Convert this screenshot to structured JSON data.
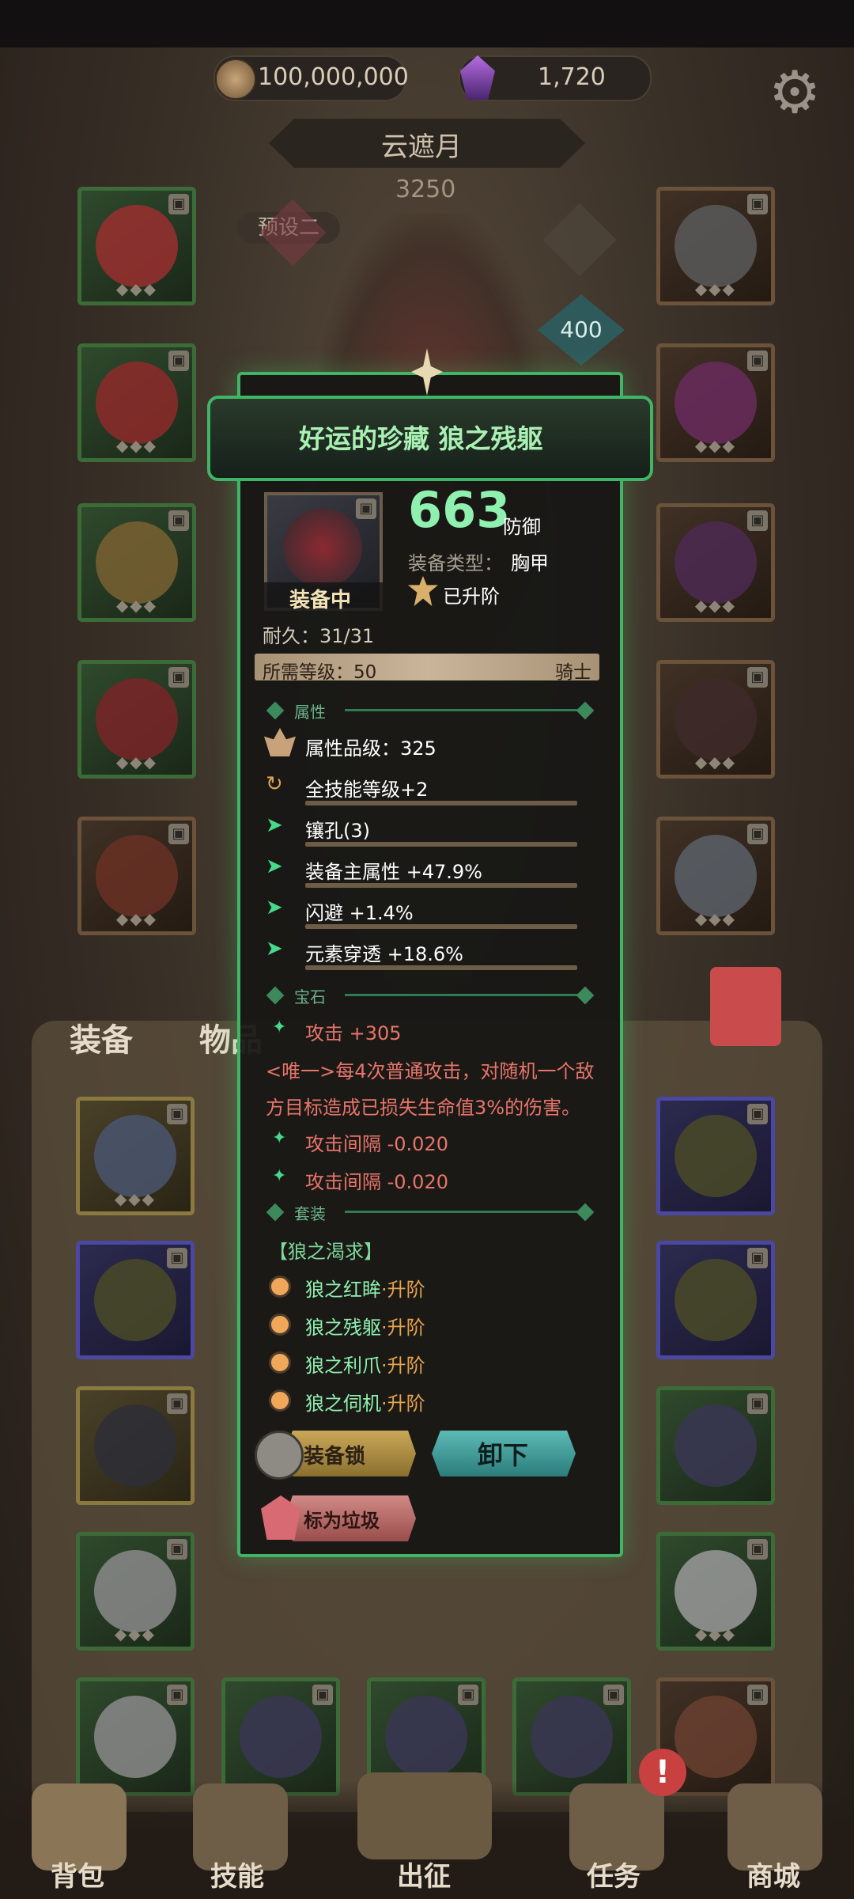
{
  "currency": {
    "coins": "100,000,000",
    "gems": "1,720"
  },
  "character": {
    "name": "云遮月",
    "power": "3250",
    "preset": "预设二",
    "level_badge": "400"
  },
  "tabs": [
    {
      "label": "装备"
    },
    {
      "label": "物品"
    }
  ],
  "item": {
    "title": "好运的珍藏 狼之残躯",
    "equipped_label": "装备中",
    "value": "663",
    "value_unit": "防御",
    "type_label": "装备类型：",
    "type_value": "胸甲",
    "ascended": "已升阶",
    "durability": "耐久：31/31",
    "required_level": "所需等级：50",
    "class": "骑士",
    "sections": {
      "attributes": "属性",
      "gems": "宝石",
      "set": "套装"
    },
    "attributes": [
      {
        "text": "属性品级：325",
        "icon": "quality-icon"
      },
      {
        "text": "全技能等级+2",
        "icon": "refresh-icon"
      },
      {
        "text": "镶孔(3)",
        "icon": "arrow-icon"
      },
      {
        "text": "装备主属性 +47.9%",
        "icon": "arrow-icon"
      },
      {
        "text": "闪避 +1.4%",
        "icon": "arrow-icon"
      },
      {
        "text": "元素穿透 +18.6%",
        "icon": "arrow-icon"
      }
    ],
    "gem_stats": [
      {
        "text": "攻击 +305"
      },
      {
        "text": "攻击间隔 -0.020"
      },
      {
        "text": "攻击间隔 -0.020"
      }
    ],
    "unique_line1": "<唯一>每4次普通攻击，对随机一个敌",
    "unique_line2": "方目标造成已损失生命值3%的伤害。",
    "set_name": "【狼之渴求】",
    "set_items": [
      {
        "name": "狼之红眸",
        "tag": "·升阶"
      },
      {
        "name": "狼之残躯",
        "tag": "·升阶"
      },
      {
        "name": "狼之利爪",
        "tag": "·升阶"
      },
      {
        "name": "狼之伺机",
        "tag": "·升阶"
      }
    ],
    "buttons": {
      "lock": "装备锁",
      "unequip": "卸下",
      "junk": "标为垃圾"
    }
  },
  "nav": [
    {
      "label": "背包"
    },
    {
      "label": "技能"
    },
    {
      "label": "出征"
    },
    {
      "label": "任务"
    },
    {
      "label": "商城"
    }
  ],
  "colors": {
    "accent": "#41b566",
    "stat_value": "#8ff0b0",
    "unique_text": "#e8756a",
    "set_tag": "#e6a34c"
  }
}
